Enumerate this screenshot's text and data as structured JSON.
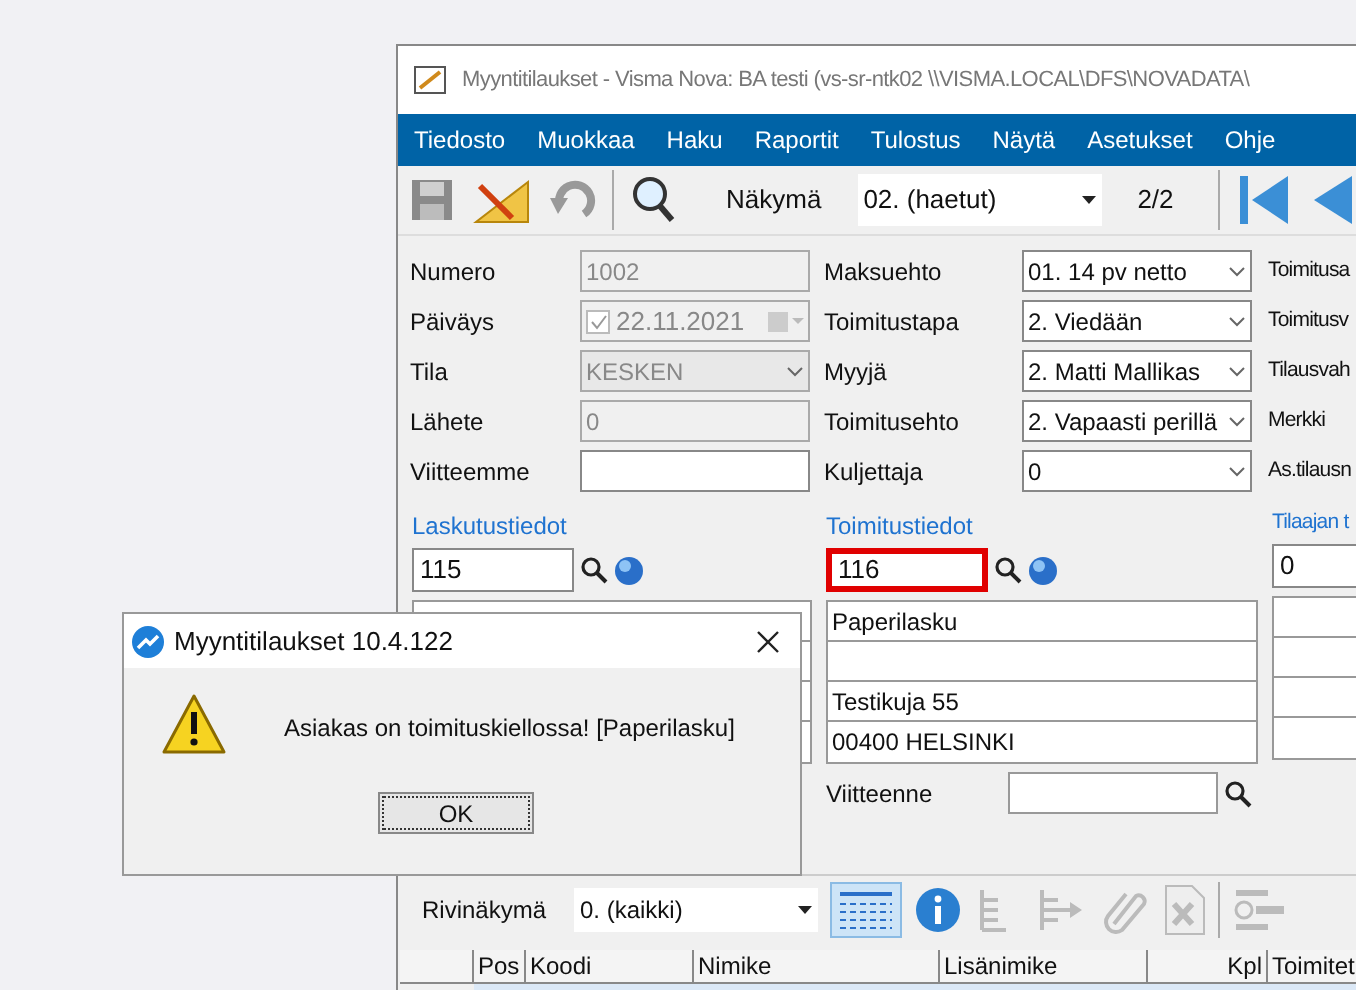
{
  "window": {
    "title": "Myyntitilaukset - Visma Nova: BA testi (vs-sr-ntk02 \\\\VISMA.LOCAL\\DFS\\NOVADATA\\"
  },
  "menu": [
    "Tiedosto",
    "Muokkaa",
    "Haku",
    "Raportit",
    "Tulostus",
    "Näytä",
    "Asetukset",
    "Ohje"
  ],
  "toolbar": {
    "view_label": "Näkymä",
    "view_value": "02. (haetut)",
    "record_counter": "2/2"
  },
  "fields_left": [
    {
      "label": "Numero",
      "value": "1002",
      "kind": "text",
      "disabled": true
    },
    {
      "label": "Päiväys",
      "value": "22.11.2021",
      "kind": "date",
      "disabled": true,
      "checked": true
    },
    {
      "label": "Tila",
      "value": "KESKEN",
      "kind": "select",
      "disabled": true
    },
    {
      "label": "Lähete",
      "value": "0",
      "kind": "text",
      "disabled": true
    },
    {
      "label": "Viitteemme",
      "kind": "text",
      "disabled": false
    }
  ],
  "fields_middle": [
    {
      "label": "Maksuehto",
      "value": "01. 14 pv netto"
    },
    {
      "label": "Toimitustapa",
      "value": "2. Viedään"
    },
    {
      "label": "Myyjä",
      "value": "2. Matti Mallikas"
    },
    {
      "label": "Toimitusehto",
      "value": "2. Vapaasti perillä"
    },
    {
      "label": "Kuljettaja",
      "value": "0"
    }
  ],
  "fields_right": [
    "Toimitusa",
    "Toimitusv",
    "Tilausvah",
    "Merkki",
    "As.tilausn"
  ],
  "sections": [
    {
      "heading": "Laskutustiedot",
      "customer": "115",
      "highlighted": false
    },
    {
      "heading": "Toimitustiedot",
      "customer": "116",
      "highlighted": true,
      "address": {
        "name": "Paperilasku",
        "street": "Testikuja 55",
        "postal_city": "00400 HELSINKI"
      }
    },
    {
      "heading": "Tilaajan t",
      "customer": "0",
      "highlighted": false
    }
  ],
  "reference": {
    "label": "Viitteenne"
  },
  "rows_toolbar": {
    "label": "Rivinäkymä",
    "value": "0. (kaikki)"
  },
  "table": {
    "columns": [
      "",
      "Pos",
      "Koodi",
      "Nimike",
      "Lisänimike",
      "Kpl",
      "Toimitet"
    ]
  },
  "dialog": {
    "title": "Myyntitilaukset 10.4.122",
    "message": "Asiakas on toimituskiellossa! [Paperilasku]",
    "button": "OK"
  }
}
